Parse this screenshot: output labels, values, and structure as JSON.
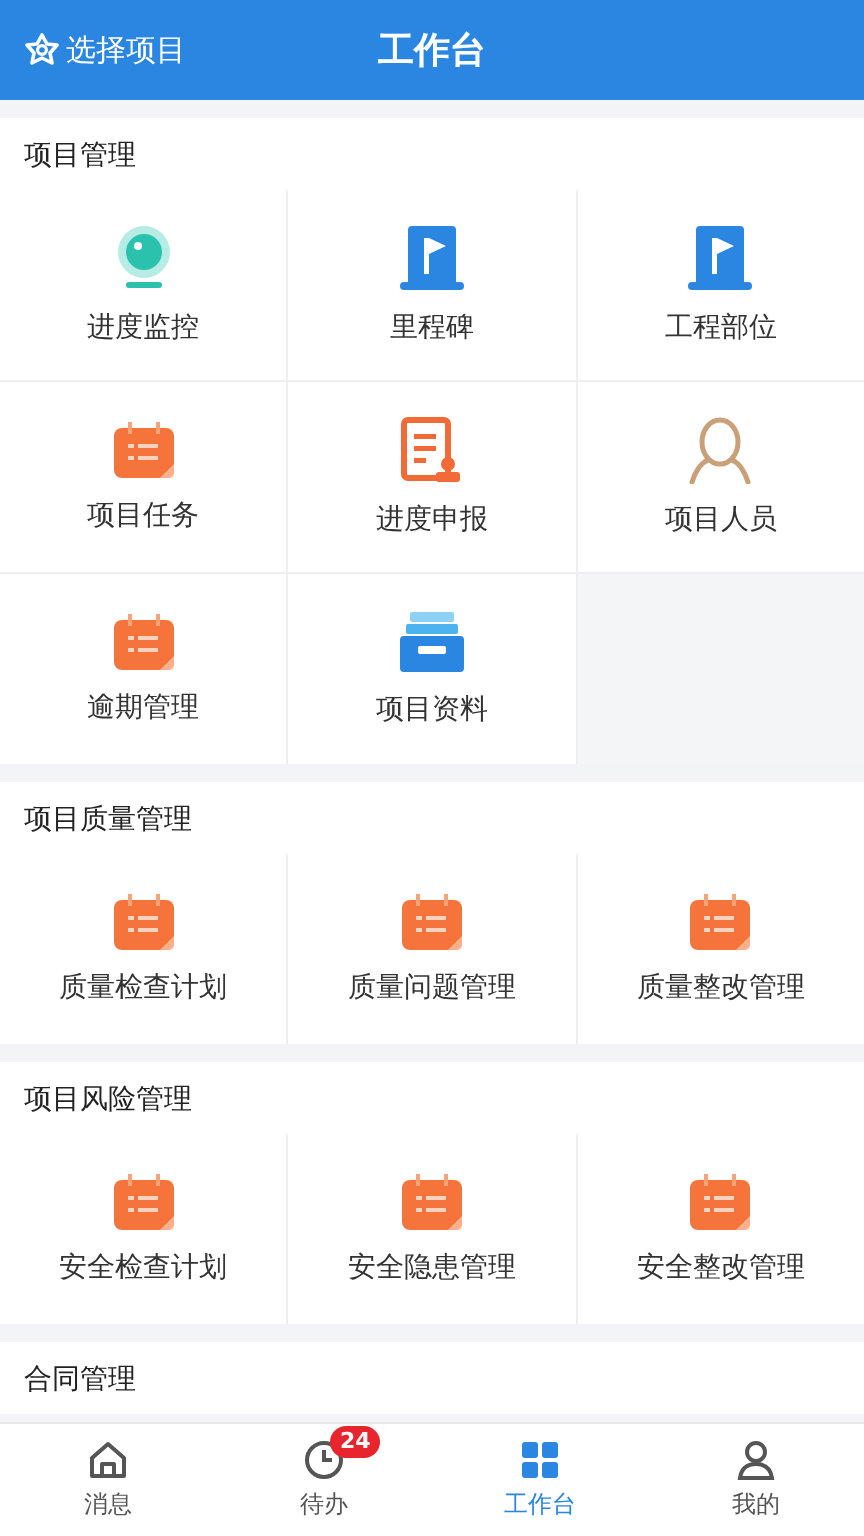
{
  "header": {
    "project_button": "选择项目",
    "title": "工作台"
  },
  "sections": [
    {
      "title": "项目管理",
      "items": [
        {
          "label": "进度监控",
          "kind": "camera"
        },
        {
          "label": "里程碑",
          "kind": "flag"
        },
        {
          "label": "工程部位",
          "kind": "flag"
        },
        {
          "label": "项目任务",
          "kind": "calendar"
        },
        {
          "label": "进度申报",
          "kind": "report"
        },
        {
          "label": "项目人员",
          "kind": "person"
        },
        {
          "label": "逾期管理",
          "kind": "calendar"
        },
        {
          "label": "项目资料",
          "kind": "tray"
        }
      ]
    },
    {
      "title": "项目质量管理",
      "items": [
        {
          "label": "质量检查计划",
          "kind": "calendar"
        },
        {
          "label": "质量问题管理",
          "kind": "calendar"
        },
        {
          "label": "质量整改管理",
          "kind": "calendar"
        }
      ]
    },
    {
      "title": "项目风险管理",
      "items": [
        {
          "label": "安全检查计划",
          "kind": "calendar"
        },
        {
          "label": "安全隐患管理",
          "kind": "calendar"
        },
        {
          "label": "安全整改管理",
          "kind": "calendar"
        }
      ]
    },
    {
      "title": "合同管理"
    }
  ],
  "tabs": [
    {
      "label": "消息",
      "kind": "home",
      "selected": false
    },
    {
      "label": "待办",
      "kind": "clock",
      "selected": false,
      "badge": "24"
    },
    {
      "label": "工作台",
      "kind": "grid",
      "selected": true
    },
    {
      "label": "我的",
      "kind": "user",
      "selected": false
    }
  ]
}
